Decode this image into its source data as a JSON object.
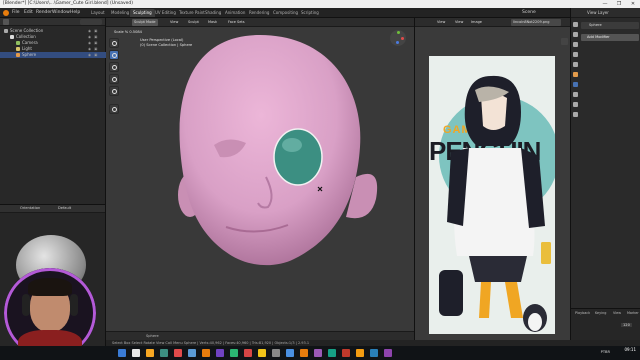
{
  "window": {
    "title": "[Blender*] [C:\\Users\\...\\Gamer_Cute Girl.blend] (Unsaved)",
    "controls": [
      "—",
      "❐",
      "✕"
    ]
  },
  "menu": {
    "items": [
      "File",
      "Edit",
      "Render",
      "Window",
      "Help"
    ],
    "workspaces": [
      "Layout",
      "Modeling",
      "Sculpting",
      "UV Editing",
      "Texture Paint",
      "Shading",
      "Animation",
      "Rendering",
      "Compositing",
      "Scripting"
    ],
    "active_workspace": "Sculpting",
    "scene": "Scene",
    "view_layer": "View Layer"
  },
  "outliner": {
    "rows": [
      {
        "label": "Scene Collection",
        "indent": 0,
        "icon_color": "#aaaaaa",
        "selected": false
      },
      {
        "label": "Collection",
        "indent": 1,
        "icon_color": "#dddddd",
        "selected": false
      },
      {
        "label": "Camera",
        "indent": 2,
        "icon_color": "#8fbf5f",
        "selected": false
      },
      {
        "label": "Light",
        "indent": 2,
        "icon_color": "#d8c46a",
        "selected": false
      },
      {
        "label": "Sphere",
        "indent": 2,
        "icon_color": "#e39b4b",
        "selected": true
      }
    ],
    "header_label": "Scene Collection"
  },
  "properties_small": {
    "tabs": [
      "Orientation",
      "Default"
    ],
    "label": "Sphere"
  },
  "viewport": {
    "mode": "Sculpt Mode",
    "header_buttons": [
      "View",
      "Sculpt",
      "Mask",
      "Face Sets"
    ],
    "info_lines": [
      "Scale % 0.5084",
      "User Perspective (Local)",
      "(0) Scene Collection | Sphere"
    ],
    "brush_tools": [
      "draw",
      "clay",
      "smooth",
      "grab",
      "mask",
      "annotate"
    ],
    "bottom_label": "Sphere"
  },
  "image_editor": {
    "header_buttons": [
      "View",
      "View",
      "Image"
    ],
    "image_name": "lincoln8Not2209.png",
    "artwork_text": [
      "GAMER",
      "PENGUIN"
    ],
    "slot": "Slot"
  },
  "right_properties": {
    "object_name": "Sphere",
    "section": "Add Modifier",
    "view_layer": "View Layer",
    "bottom_labels": [
      "Playback",
      "Keying",
      "View",
      "Marker"
    ],
    "frame": "120"
  },
  "status_bar": {
    "text": "Select    Box Select    Rotate View    Call Menu    Sphere | Verts:40,962 | Faces:40,960 | Tris:81,920 | Objects:1/3 | 2.93.1"
  },
  "taskbar": {
    "time": "09:11",
    "date": "04/07/2021",
    "lang": "PTBR"
  },
  "colors": {
    "skin": "#d9a0c6",
    "skin_shadow": "#b57aa3",
    "eye_teal": "#3c8f82",
    "accent_blue": "#4772b3",
    "art_bg": "#e9efec",
    "art_teal": "#7ec4c0",
    "art_yellow": "#f0a623"
  }
}
